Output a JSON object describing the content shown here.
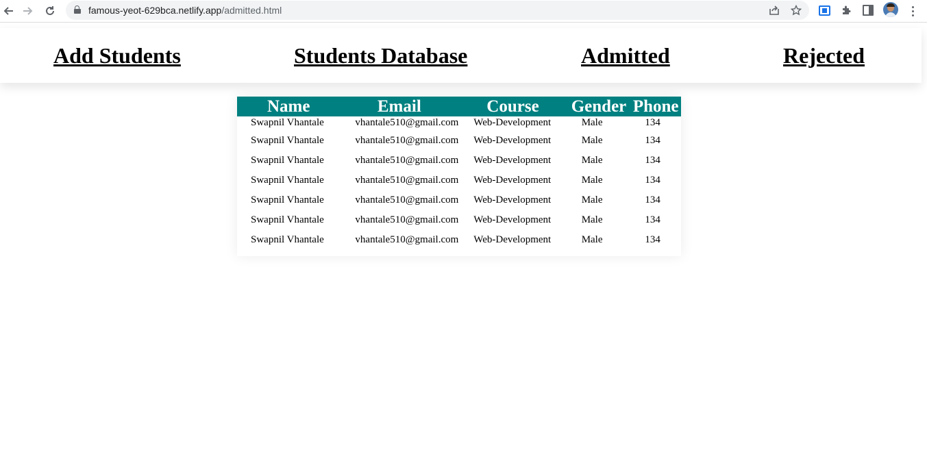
{
  "browser": {
    "url_host": "famous-yeot-629bca.netlify.app",
    "url_path": "/admitted.html",
    "icons": [
      "back-icon",
      "forward-icon",
      "reload-icon",
      "lock-icon",
      "share-icon",
      "star-icon",
      "screen-capture-icon",
      "extensions-icon",
      "side-panel-icon",
      "profile-avatar",
      "menu-icon"
    ]
  },
  "nav": {
    "links": [
      "Add Students",
      "Students Database",
      "Admitted",
      "Rejected"
    ]
  },
  "table": {
    "header_color": "#008080",
    "columns": [
      "Name",
      "Email",
      "Course",
      "Gender",
      "Phone"
    ],
    "rows": [
      [
        "Swapnil Vhantale",
        "vhantale510@gmail.com",
        "Web-Development",
        "Male",
        "134"
      ],
      [
        "Swapnil Vhantale",
        "vhantale510@gmail.com",
        "Web-Development",
        "Male",
        "134"
      ],
      [
        "Swapnil Vhantale",
        "vhantale510@gmail.com",
        "Web-Development",
        "Male",
        "134"
      ],
      [
        "Swapnil Vhantale",
        "vhantale510@gmail.com",
        "Web-Development",
        "Male",
        "134"
      ],
      [
        "Swapnil Vhantale",
        "vhantale510@gmail.com",
        "Web-Development",
        "Male",
        "134"
      ],
      [
        "Swapnil Vhantale",
        "vhantale510@gmail.com",
        "Web-Development",
        "Male",
        "134"
      ],
      [
        "Swapnil Vhantale",
        "vhantale510@gmail.com",
        "Web-Development",
        "Male",
        "134"
      ]
    ]
  }
}
